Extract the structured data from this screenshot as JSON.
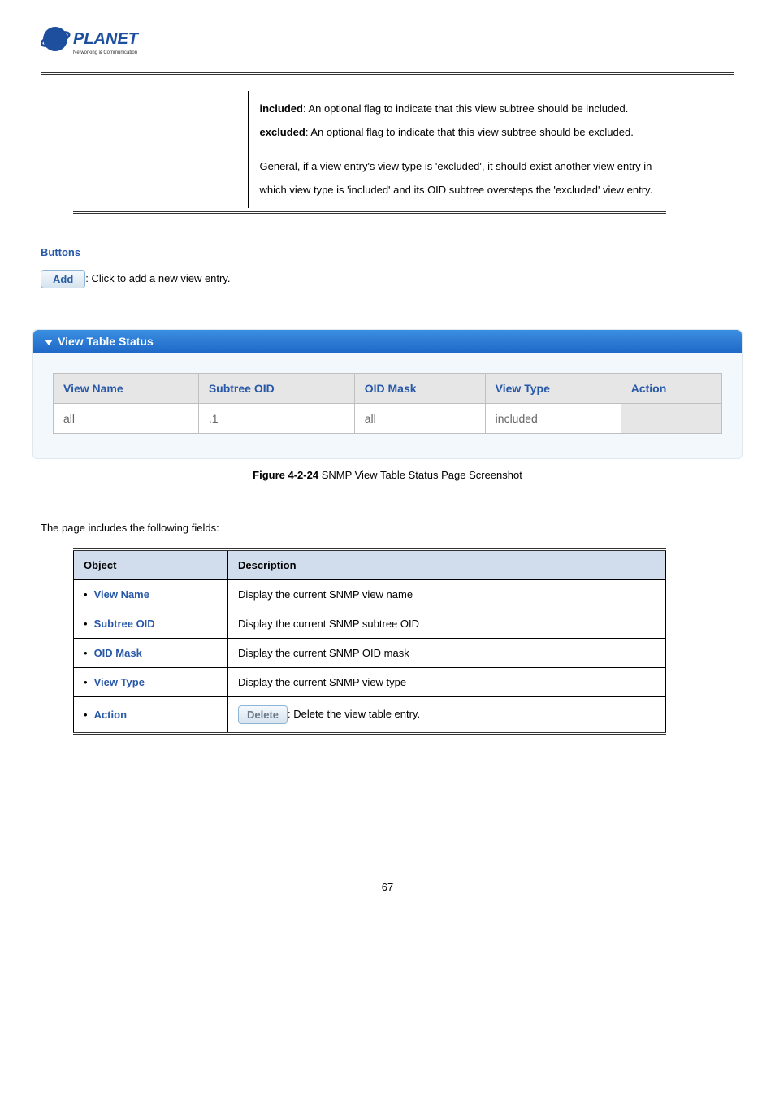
{
  "logo": {
    "brand": "PLANET",
    "tagline": "Networking & Communication"
  },
  "top_desc": {
    "included_label": "included",
    "included_text": ": An optional flag to indicate that this view subtree should be included.",
    "excluded_label": "excluded",
    "excluded_text": ": An optional flag to indicate that this view subtree should be excluded.",
    "general": "General, if a view entry's view type is 'excluded', it should exist another view entry in which view type is 'included' and its OID subtree oversteps the 'excluded' view entry."
  },
  "buttons_section": {
    "heading": "Buttons",
    "add_label": "Add",
    "add_text": ": Click to add a new view entry."
  },
  "status": {
    "title": "View Table Status",
    "headers": {
      "view_name": "View Name",
      "subtree_oid": "Subtree OID",
      "oid_mask": "OID Mask",
      "view_type": "View Type",
      "action": "Action"
    },
    "row": {
      "view_name": "all",
      "subtree_oid": ".1",
      "oid_mask": "all",
      "view_type": "included",
      "action": ""
    }
  },
  "figure": {
    "label": "Figure 4-2-24",
    "text": " SNMP View Table Status Page Screenshot"
  },
  "fields_intro": "The page includes the following fields:",
  "fields_table": {
    "h_object": "Object",
    "h_desc": "Description",
    "rows": [
      {
        "object": "View Name",
        "desc": "Display the current SNMP view name"
      },
      {
        "object": "Subtree OID",
        "desc": "Display the current SNMP subtree OID"
      },
      {
        "object": "OID Mask",
        "desc": "Display the current SNMP OID mask"
      },
      {
        "object": "View Type",
        "desc": "Display the current SNMP view type"
      }
    ],
    "action_label": "Action",
    "delete_btn": "Delete",
    "delete_text": ": Delete the view table entry."
  },
  "page_number": "67"
}
